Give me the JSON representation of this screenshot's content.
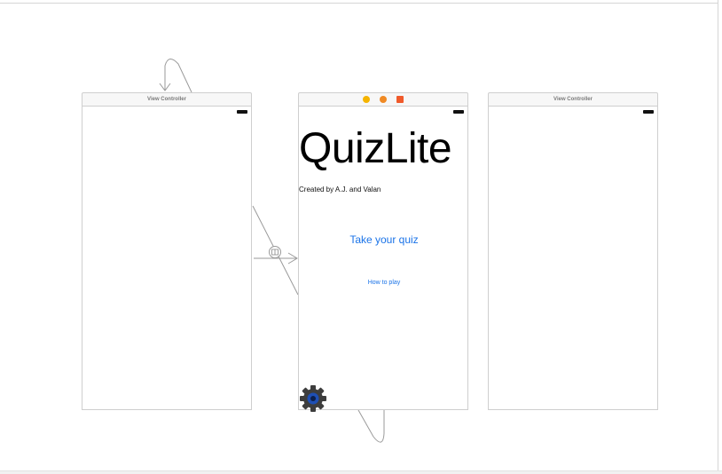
{
  "scenes": [
    {
      "id": "scene-1",
      "title": "View Controller"
    },
    {
      "id": "scene-2",
      "title": "",
      "dock_icons": [
        {
          "name": "view-controller-icon",
          "color": "#f5b400"
        },
        {
          "name": "first-responder-icon",
          "color": "#f08a24"
        },
        {
          "name": "exit-icon",
          "color": "#f05a2b"
        }
      ],
      "app_title": "QuizLite",
      "credits": "Created by A.J. and Valan",
      "take_quiz_button": "Take your quiz",
      "how_to_button": "How to play",
      "settings_icon": "gear-icon"
    },
    {
      "id": "scene-3",
      "title": "View Controller"
    }
  ],
  "colors": {
    "link": "#1a73e8",
    "segue_line": "#9a9a9a",
    "scene_border": "#cfcfcf"
  }
}
